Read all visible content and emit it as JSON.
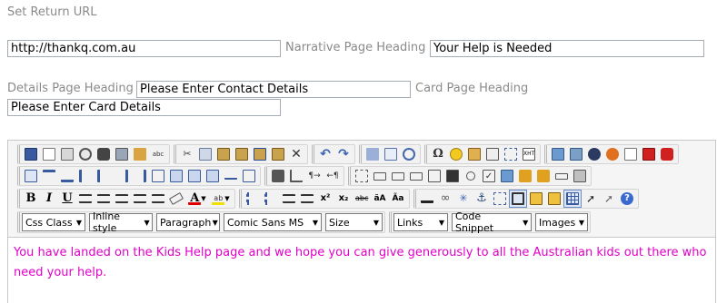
{
  "form": {
    "return_url_label": "Set Return URL",
    "return_url_value": "http://thankq.com.au",
    "narrative_heading_label": "Narrative Page Heading",
    "narrative_heading_value": "Your Help is Needed",
    "details_heading_label": "Details Page Heading",
    "details_heading_value": "Please Enter Contact Details",
    "card_heading_label": "Card Page Heading",
    "card_heading_value": "Please Enter Card Details"
  },
  "editor": {
    "dropdowns": {
      "css_class": "Css Class",
      "inline_style": "Inline style",
      "paragraph": "Paragraph",
      "font": "Comic Sans MS",
      "size": "Size",
      "links": "Links",
      "code_snippet": "Code Snippet",
      "images": "Images"
    },
    "format_labels": {
      "bold": "B",
      "italic": "I",
      "underline": "U",
      "superscript": "x²",
      "subscript": "x₂",
      "spellcheck": "abc",
      "special_char": "Ω"
    },
    "content": "You have landed on the Kids Help page and we hope you can give generously to all the Australian kids out there who need your help."
  },
  "colors": {
    "content_text": "#e000c8",
    "label_text": "#8a8a8a"
  }
}
